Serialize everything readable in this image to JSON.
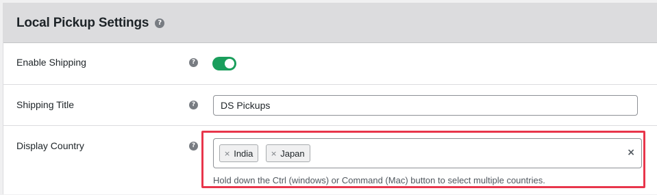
{
  "header": {
    "title": "Local Pickup Settings",
    "help_glyph": "?"
  },
  "rows": {
    "enable_shipping": {
      "label": "Enable Shipping",
      "help_glyph": "?",
      "toggle_on": true
    },
    "shipping_title": {
      "label": "Shipping Title",
      "help_glyph": "?",
      "value": "DS Pickups"
    },
    "display_country": {
      "label": "Display Country",
      "help_glyph": "?",
      "selected": [
        {
          "label": "India",
          "remove_glyph": "×"
        },
        {
          "label": "Japan",
          "remove_glyph": "×"
        }
      ],
      "clear_glyph": "×",
      "hint": "Hold down the Ctrl (windows) or Command (Mac) button to select multiple countries."
    }
  },
  "colors": {
    "toggle_on": "#1a9e5c",
    "highlight_border": "#e8354b",
    "header_bg": "#dcdcde"
  },
  "icons": {
    "help": "question-circle-icon",
    "remove_chip": "x-icon",
    "clear": "x-icon"
  }
}
